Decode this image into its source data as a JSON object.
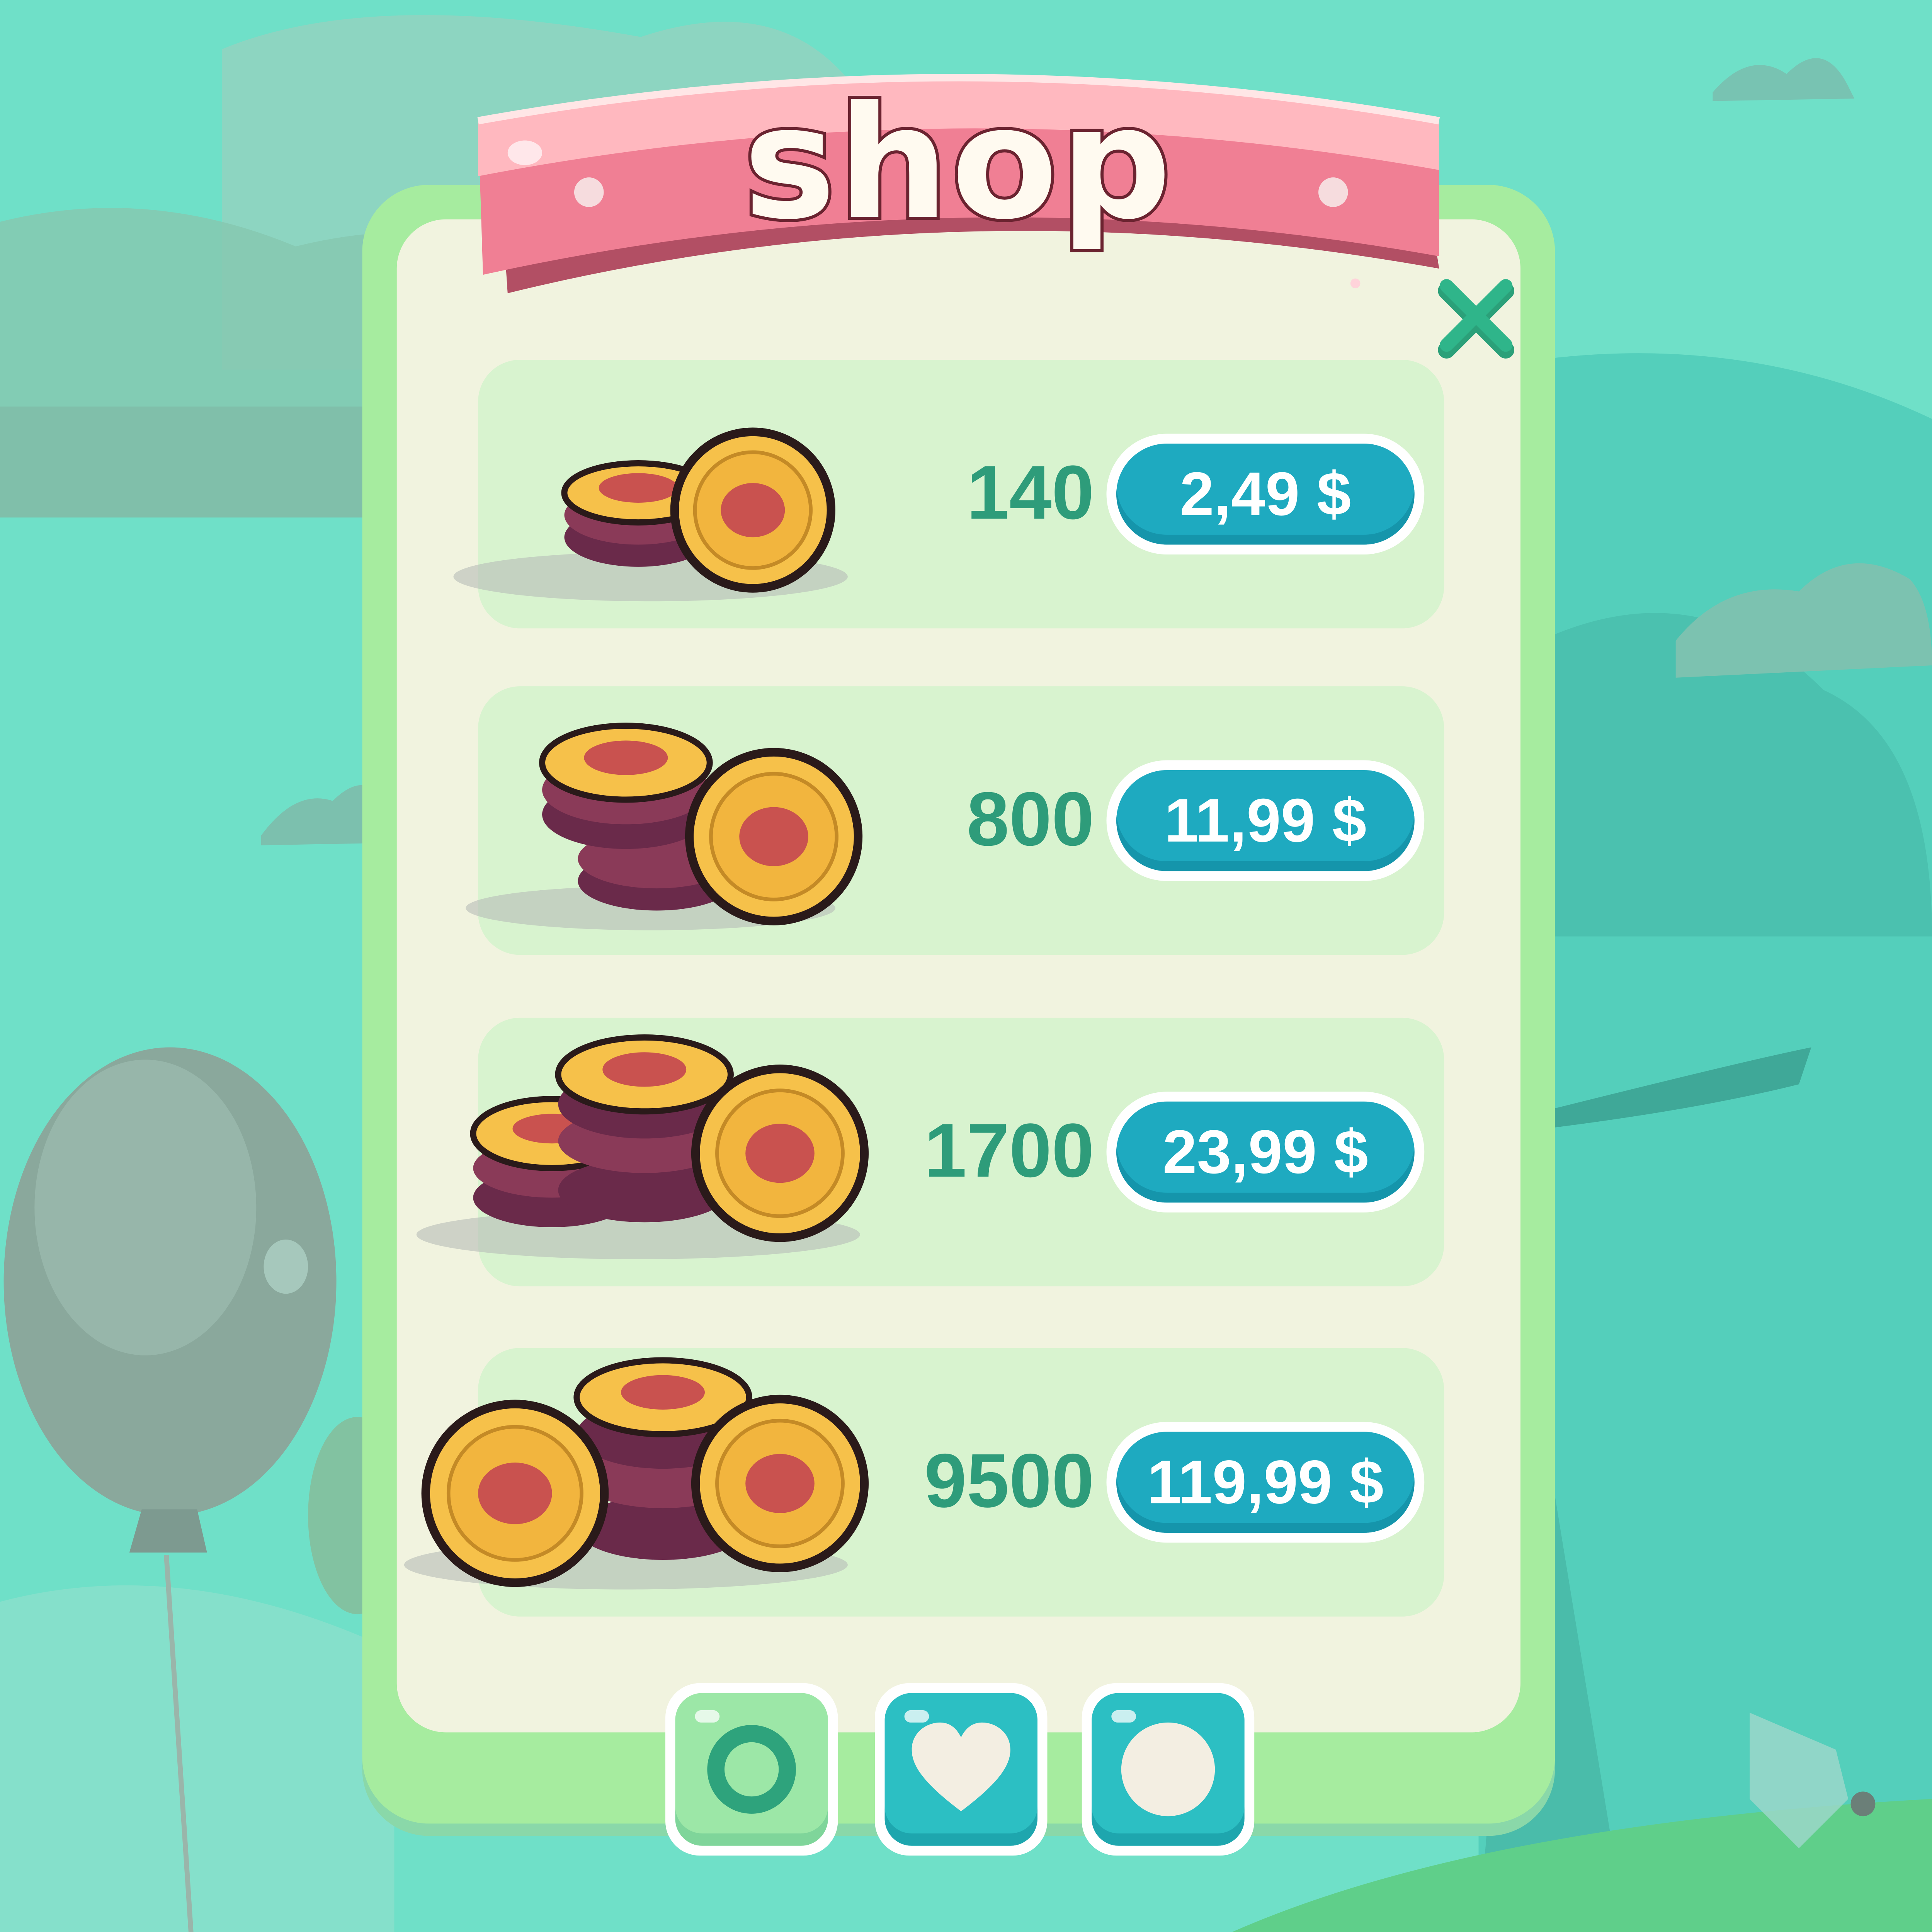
{
  "title": "shop",
  "close_icon": "close-x-icon",
  "colors": {
    "background": "#6fe0c8",
    "panel_border": "#a6ec9f",
    "panel_fill": "#f1f3df",
    "card_fill": "#d8f3cf",
    "amount_text": "#2e9c7a",
    "price_button": "#1eaac0",
    "banner": "#f07f94",
    "coin_gold": "#f6c14a",
    "coin_emblem": "#c9524f"
  },
  "offers": [
    {
      "amount": "140",
      "price": "2,49 $",
      "icon": "coin-stack-small-icon"
    },
    {
      "amount": "800",
      "price": "11,99 $",
      "icon": "coin-stack-medium-icon"
    },
    {
      "amount": "1700",
      "price": "23,99 $",
      "icon": "coin-stack-large-icon"
    },
    {
      "amount": "9500",
      "price": "119,99 $",
      "icon": "coin-stack-huge-icon"
    }
  ],
  "bottom_buttons": [
    {
      "icon": "ring-icon",
      "state": "active"
    },
    {
      "icon": "heart-icon",
      "state": "normal"
    },
    {
      "icon": "circle-icon",
      "state": "normal"
    }
  ]
}
